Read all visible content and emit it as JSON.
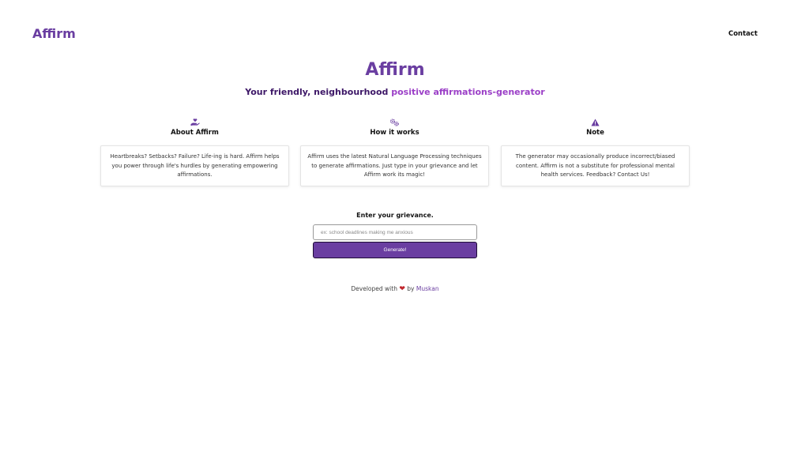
{
  "nav": {
    "brand": "Affirm",
    "contact": "Contact"
  },
  "hero": {
    "title": "Affirm",
    "tagline_part1": "Your friendly, neighbourhood ",
    "tagline_part2": "positive affirmations-generator"
  },
  "features": [
    {
      "icon": "hand-holding-heart-icon",
      "title": "About Affirm",
      "text": "Heartbreaks? Setbacks? Failure? Life-ing is hard. Affirm helps you power through life's hurdles by generating empowering affirmations."
    },
    {
      "icon": "gears-icon",
      "title": "How it works",
      "text": "Affirm uses the latest Natural Language Processing techniques to generate affirmations. Just type in your grievance and let Affirm work its magic!"
    },
    {
      "icon": "warning-icon",
      "title": "Note",
      "text": "The generator may occasionally produce incorrect/biased content. Affirm is not a substitute for professional mental health services. Feedback? Contact Us!"
    }
  ],
  "form": {
    "label": "Enter your grievance.",
    "placeholder": "ex: school deadlines making me anxious",
    "value": "",
    "button": "Generate!"
  },
  "footer": {
    "prefix": "Developed with",
    "heart": "❤",
    "by": "by",
    "author": "Muskan"
  },
  "colors": {
    "accent": "#6a3ea1",
    "tagline_dark": "#3d1767",
    "tagline_light": "#9b3fc7",
    "heart": "#c0272d"
  }
}
